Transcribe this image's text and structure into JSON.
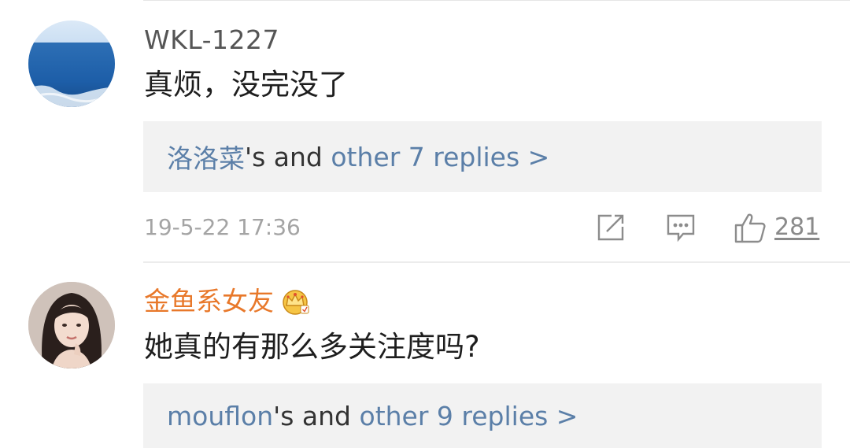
{
  "comments": [
    {
      "username": "WKL-1227",
      "text": "真烦，没完没了",
      "replies": {
        "first_replier": "洛洛菜",
        "middle": "'s and ",
        "rest": "other 7 replies >"
      },
      "timestamp": "19-5-22 17:36",
      "like_count": "281"
    },
    {
      "username": "金鱼系女友",
      "badge_icon": "vip-crown-icon",
      "text": "她真的有那么多关注度吗?",
      "replies": {
        "first_replier": "mouflon",
        "middle": "'s and ",
        "rest": "other 9 replies >"
      }
    }
  ],
  "colors": {
    "link": "#5b7fa8",
    "vip_username": "#e8782a",
    "meta": "#a4a4a4",
    "reply_bg": "#f2f2f2"
  },
  "icons": [
    "share-icon",
    "comment-icon",
    "like-icon"
  ]
}
